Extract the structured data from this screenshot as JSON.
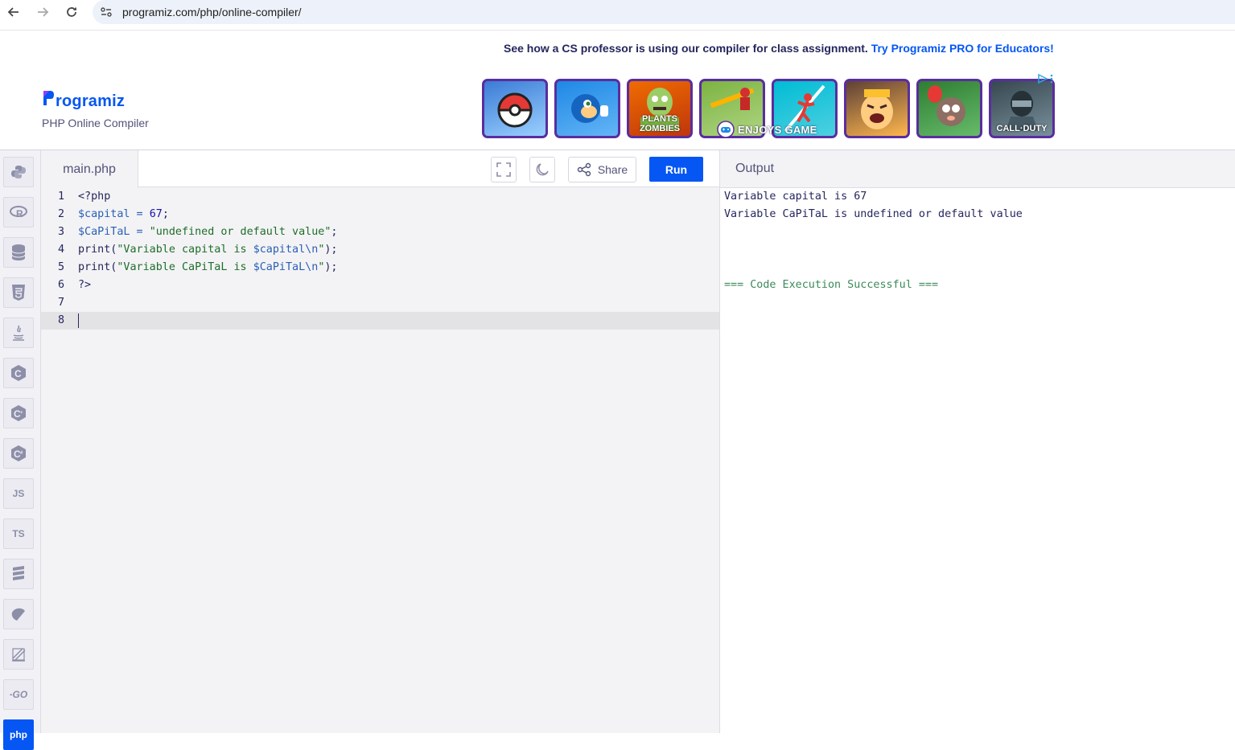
{
  "browser": {
    "url": "programiz.com/php/online-compiler/"
  },
  "header": {
    "promo_text": "See how a CS professor is using our compiler for class assignment.",
    "promo_link": "Try Programiz PRO for Educators!",
    "logo_text": "rogramiz",
    "subtitle": "PHP Online Compiler"
  },
  "ads": {
    "tiles": [
      {
        "name": "pokemon-go",
        "label": ""
      },
      {
        "name": "sonic",
        "label": ""
      },
      {
        "name": "plants-vs-zombies",
        "label": "PLANTS ZOMBIES"
      },
      {
        "name": "pull-pin",
        "label": ""
      },
      {
        "name": "stickman",
        "label": ""
      },
      {
        "name": "clash",
        "label": ""
      },
      {
        "name": "bloons",
        "label": ""
      },
      {
        "name": "call-of-duty",
        "label": "CALL·DUTY"
      }
    ],
    "overlay_text": "ENJOYS GAME"
  },
  "sidebar": {
    "items": [
      {
        "name": "python",
        "label": ""
      },
      {
        "name": "r",
        "label": ""
      },
      {
        "name": "sql",
        "label": ""
      },
      {
        "name": "html",
        "label": ""
      },
      {
        "name": "java",
        "label": ""
      },
      {
        "name": "c",
        "label": ""
      },
      {
        "name": "cpp",
        "label": ""
      },
      {
        "name": "csharp",
        "label": ""
      },
      {
        "name": "js",
        "label": "JS"
      },
      {
        "name": "ts",
        "label": "TS"
      },
      {
        "name": "sql2",
        "label": ""
      },
      {
        "name": "kotlin",
        "label": ""
      },
      {
        "name": "swift",
        "label": ""
      },
      {
        "name": "go",
        "label": "GO"
      },
      {
        "name": "php",
        "label": "php"
      }
    ]
  },
  "editor": {
    "file_tab": "main.php",
    "share_label": "Share",
    "run_label": "Run",
    "lines": [
      {
        "num": "1",
        "tokens": [
          {
            "t": "<?php",
            "c": ""
          }
        ]
      },
      {
        "num": "2",
        "tokens": [
          {
            "t": "$capital",
            "c": "var"
          },
          {
            "t": " = ",
            "c": "op"
          },
          {
            "t": "67",
            "c": "num"
          },
          {
            "t": ";",
            "c": ""
          }
        ]
      },
      {
        "num": "3",
        "tokens": [
          {
            "t": "$CaPiTaL",
            "c": "var"
          },
          {
            "t": " = ",
            "c": "op"
          },
          {
            "t": "\"undefined or default value\"",
            "c": "str"
          },
          {
            "t": ";",
            "c": ""
          }
        ]
      },
      {
        "num": "4",
        "tokens": [
          {
            "t": "print(",
            "c": ""
          },
          {
            "t": "\"Variable capital is ",
            "c": "str"
          },
          {
            "t": "$capital\\n",
            "c": "var"
          },
          {
            "t": "\"",
            "c": "str"
          },
          {
            "t": ");",
            "c": ""
          }
        ]
      },
      {
        "num": "5",
        "tokens": [
          {
            "t": "print(",
            "c": ""
          },
          {
            "t": "\"Variable CaPiTaL is ",
            "c": "str"
          },
          {
            "t": "$CaPiTaL\\n",
            "c": "var"
          },
          {
            "t": "\"",
            "c": "str"
          },
          {
            "t": ");",
            "c": ""
          }
        ]
      },
      {
        "num": "6",
        "tokens": [
          {
            "t": "?>",
            "c": ""
          }
        ]
      },
      {
        "num": "7",
        "tokens": []
      },
      {
        "num": "8",
        "tokens": []
      }
    ]
  },
  "output": {
    "title": "Output",
    "lines": [
      {
        "text": "Variable capital is 67",
        "kind": "normal"
      },
      {
        "text": "Variable CaPiTaL is undefined or default value",
        "kind": "normal"
      },
      {
        "text": "",
        "kind": "normal"
      },
      {
        "text": "",
        "kind": "normal"
      },
      {
        "text": "",
        "kind": "normal"
      },
      {
        "text": "=== Code Execution Successful ===",
        "kind": "success"
      }
    ]
  },
  "colors": {
    "brand": "#0556f3",
    "text": "#25265e",
    "success": "#3c8a5a"
  }
}
